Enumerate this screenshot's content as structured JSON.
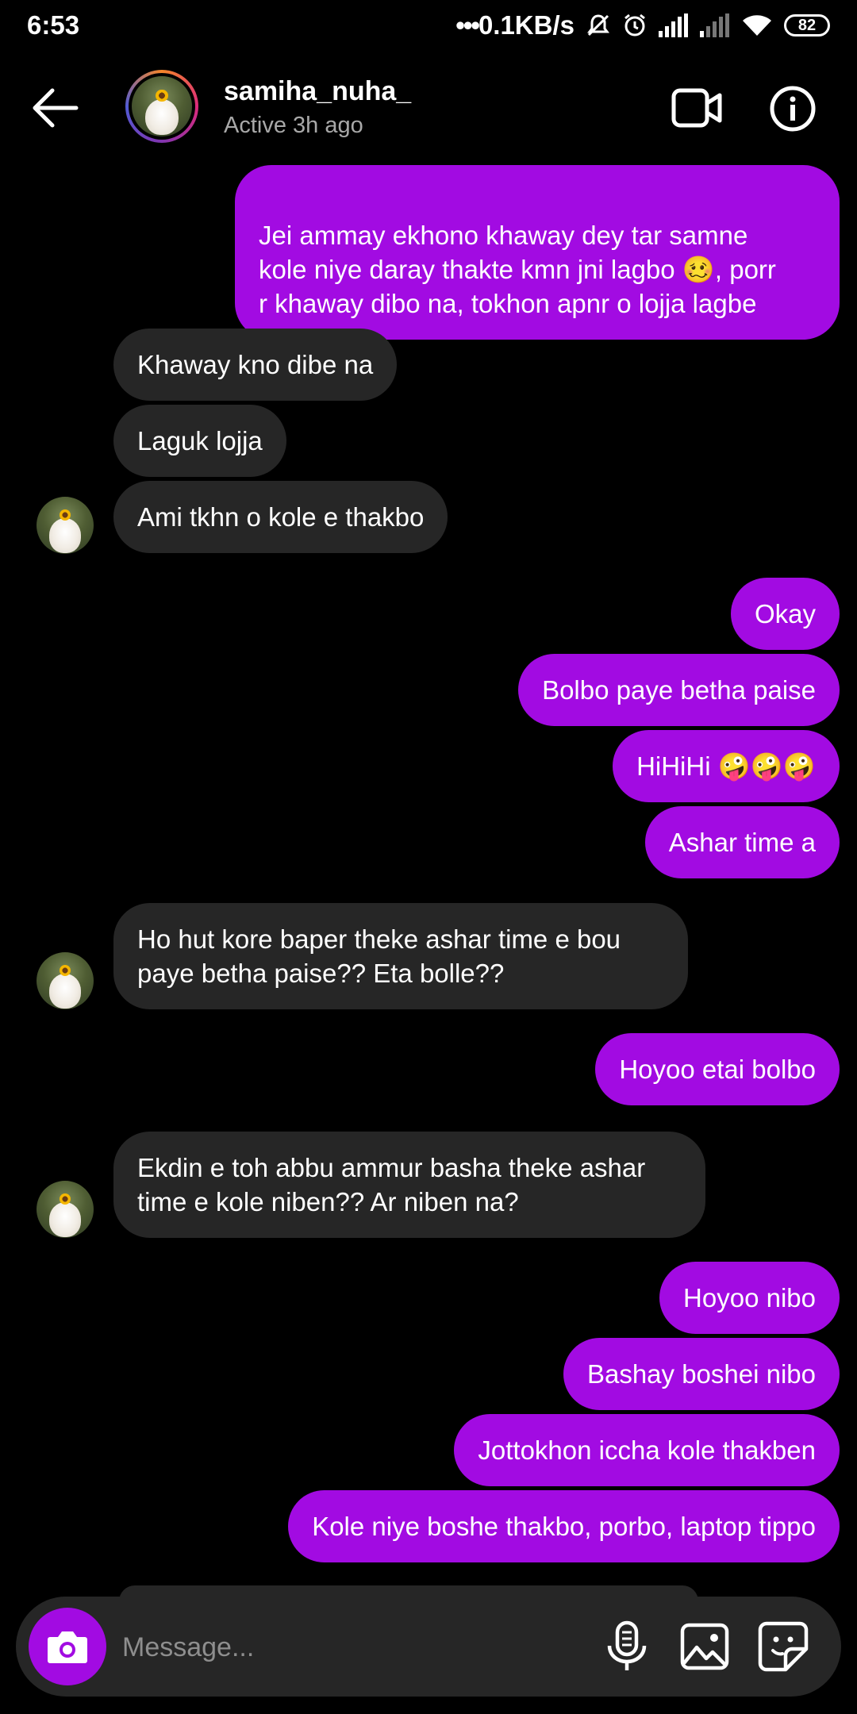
{
  "status_bar": {
    "time": "6:53",
    "network_speed": "0.1KB/s",
    "battery": "82",
    "icons": [
      "mute-icon",
      "alarm-icon",
      "signal-icon",
      "signal-weak-icon",
      "wifi-icon",
      "battery-icon"
    ]
  },
  "header": {
    "username": "samiha_nuha_",
    "status": "Active 3h ago",
    "icons": [
      "back-arrow-icon",
      "video-call-icon",
      "info-icon"
    ]
  },
  "messages": [
    {
      "from": "me",
      "text": "Jei ammay ekhono khaway dey tar samne\nkole niye daray thakte kmn jni lagbo 🥴, porr\nr khaway dibo na, tokhon apnr o lojja lagbe"
    },
    {
      "from": "them",
      "text": "Khaway kno dibe na"
    },
    {
      "from": "them",
      "text": "Laguk lojja"
    },
    {
      "from": "them",
      "text": "Ami tkhn o kole e thakbo"
    },
    {
      "from": "me",
      "text": "Okay"
    },
    {
      "from": "me",
      "text": "Bolbo paye betha paise"
    },
    {
      "from": "me",
      "text": "HiHiHi 🤪🤪🤪"
    },
    {
      "from": "me",
      "text": "Ashar time a"
    },
    {
      "from": "them",
      "text": "Ho hut kore baper theke ashar time e  bou\npaye betha paise?? Eta bolle??"
    },
    {
      "from": "me",
      "text": "Hoyoo etai bolbo"
    },
    {
      "from": "them",
      "text": "Ekdin e toh abbu ammur basha theke ashar\ntime e kole niben?? Ar niben na?"
    },
    {
      "from": "me",
      "text": "Hoyoo nibo"
    },
    {
      "from": "me",
      "text": "Bashay boshei nibo"
    },
    {
      "from": "me",
      "text": "Jottokhon iccha kole thakben"
    },
    {
      "from": "me",
      "text": "Kole niye boshe thakbo, porbo, laptop tippo"
    }
  ],
  "composer": {
    "placeholder": "Message...",
    "icons": [
      "camera-icon",
      "microphone-icon",
      "gallery-icon",
      "sticker-icon"
    ]
  },
  "colors": {
    "sent_bubble": "#a20be2",
    "received_bubble": "#262626",
    "background": "#000000"
  }
}
